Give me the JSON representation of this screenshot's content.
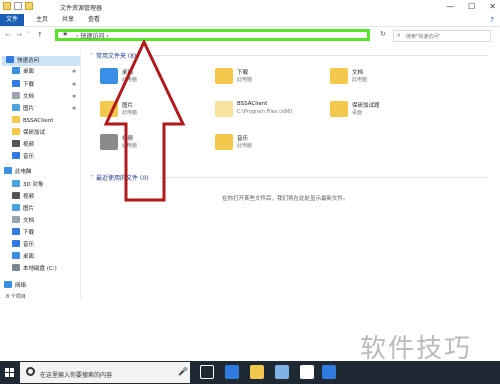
{
  "window": {
    "title": "文件资源管理器",
    "controls": [
      "—",
      "☐",
      "✕"
    ]
  },
  "ribbon": {
    "tabs": [
      "文件",
      "主页",
      "共享",
      "查看"
    ],
    "help_glyph": "?"
  },
  "navigation": {
    "back": "←",
    "forward": "→",
    "recent": "˅",
    "up": "↑",
    "address": "快速访问",
    "address_separator": "›",
    "refresh": "↻",
    "search_placeholder": "搜索\"快速访问\""
  },
  "sidebar": {
    "items": [
      {
        "label": "快速访问",
        "icon": "star-icon",
        "color": "#2f7be0",
        "selected": true
      },
      {
        "label": "桌面",
        "icon": "desktop-icon",
        "color": "#3a8ee6",
        "pinned": true
      },
      {
        "label": "下载",
        "icon": "download-icon",
        "color": "#2f7be0",
        "pinned": true
      },
      {
        "label": "文档",
        "icon": "document-icon",
        "color": "#9aa5b1",
        "pinned": true
      },
      {
        "label": "图片",
        "icon": "picture-icon",
        "color": "#4aa3df",
        "pinned": true
      },
      {
        "label": "BSSAClient",
        "icon": "folder-icon",
        "color": "#f2c94c"
      },
      {
        "label": "保研加试",
        "icon": "folder-icon",
        "color": "#f2c94c"
      },
      {
        "label": "视频",
        "icon": "video-icon",
        "color": "#555555"
      },
      {
        "label": "音乐",
        "icon": "music-icon",
        "color": "#2f7be0"
      },
      {
        "label": "此电脑",
        "icon": "computer-icon",
        "color": "#3a8ee6"
      },
      {
        "label": "3D 对象",
        "icon": "3d-objects-icon",
        "color": "#4aa3df"
      },
      {
        "label": "视频",
        "icon": "video-icon",
        "color": "#555555"
      },
      {
        "label": "图片",
        "icon": "picture-icon",
        "color": "#4aa3df"
      },
      {
        "label": "文档",
        "icon": "document-icon",
        "color": "#9aa5b1"
      },
      {
        "label": "下载",
        "icon": "download-icon",
        "color": "#2f7be0"
      },
      {
        "label": "音乐",
        "icon": "music-icon",
        "color": "#2f7be0"
      },
      {
        "label": "桌面",
        "icon": "desktop-icon",
        "color": "#3a8ee6"
      },
      {
        "label": "本地磁盘 (C:)",
        "icon": "drive-icon",
        "color": "#7a8896"
      },
      {
        "label": "网络",
        "icon": "network-icon",
        "color": "#3a8ee6"
      }
    ],
    "pin_glyph": "✱"
  },
  "content": {
    "frequent_header": "常用文件夹 (8)",
    "recent_header": "最近使用的文件 (0)",
    "folders": [
      {
        "name": "桌面",
        "sub": "此电脑",
        "color": "#3a8ee6"
      },
      {
        "name": "下载",
        "sub": "此电脑",
        "color": "#f2c94c"
      },
      {
        "name": "文档",
        "sub": "此电脑",
        "color": "#f2c94c"
      },
      {
        "name": "图片",
        "sub": "此电脑",
        "color": "#f2c94c"
      },
      {
        "name": "BSSAClient",
        "sub": "C:\\Program Files (x86)",
        "color": "#f7e2a0"
      },
      {
        "name": "保研加试题",
        "sub": "桌面",
        "color": "#f2c94c"
      },
      {
        "name": "视频",
        "sub": "此电脑",
        "color": "#8a8a8a"
      },
      {
        "name": "音乐",
        "sub": "此电脑",
        "color": "#f2c94c"
      }
    ],
    "empty_message": "在你打开某些文件后，我们将在此处显示最新文件。"
  },
  "status": {
    "count": "8 个项目"
  },
  "watermark": "软件技巧",
  "taskbar": {
    "search_text": "在这里输入你要搜索的内容",
    "apps": [
      {
        "icon": "task-view-icon",
        "color": "#ffffff"
      },
      {
        "icon": "edge-icon",
        "color": "#2f7be0"
      },
      {
        "icon": "file-explorer-icon",
        "color": "#f2c94c"
      },
      {
        "icon": "store-icon",
        "color": "#7fb3e6"
      },
      {
        "icon": "mail-icon",
        "color": "#ffffff"
      },
      {
        "icon": "app-icon",
        "color": "#2f7be0"
      }
    ]
  }
}
